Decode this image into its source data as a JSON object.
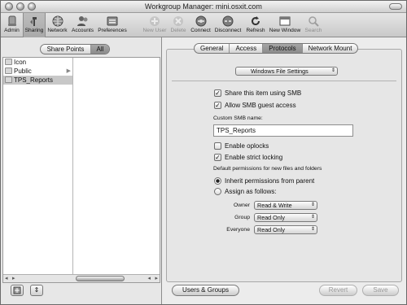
{
  "window": {
    "title": "Workgroup Manager: mini.osxit.com"
  },
  "toolbar": {
    "items": [
      {
        "label": "Admin",
        "icon": "admin-icon",
        "enabled": true
      },
      {
        "label": "Sharing",
        "icon": "sharing-icon",
        "enabled": true,
        "selected": true
      },
      {
        "label": "Network",
        "icon": "network-icon",
        "enabled": true
      },
      {
        "label": "Accounts",
        "icon": "accounts-icon",
        "enabled": true
      },
      {
        "label": "Preferences",
        "icon": "preferences-icon",
        "enabled": true
      },
      {
        "label": "New User",
        "icon": "new-user-icon",
        "enabled": false
      },
      {
        "label": "Delete",
        "icon": "delete-icon",
        "enabled": false
      },
      {
        "label": "Connect",
        "icon": "connect-icon",
        "enabled": true
      },
      {
        "label": "Disconnect",
        "icon": "disconnect-icon",
        "enabled": true
      },
      {
        "label": "Refresh",
        "icon": "refresh-icon",
        "enabled": true
      },
      {
        "label": "New Window",
        "icon": "new-window-icon",
        "enabled": true
      },
      {
        "label": "Search",
        "icon": "search-icon",
        "enabled": false
      }
    ]
  },
  "sidebar": {
    "segments": [
      {
        "label": "Share Points",
        "selected": false
      },
      {
        "label": "All",
        "selected": true
      }
    ],
    "items": [
      {
        "label": "Icon",
        "has_children": false,
        "selected": false
      },
      {
        "label": "Public",
        "has_children": true,
        "selected": false
      },
      {
        "label": "TPS_Reports",
        "has_children": false,
        "selected": true
      }
    ]
  },
  "tabs": [
    {
      "label": "General",
      "selected": false
    },
    {
      "label": "Access",
      "selected": false
    },
    {
      "label": "Protocols",
      "selected": true
    },
    {
      "label": "Network Mount",
      "selected": false
    }
  ],
  "protocol_popup": "Windows File Settings",
  "settings": {
    "share_smb": {
      "label": "Share this item using SMB",
      "checked": true
    },
    "allow_guest": {
      "label": "Allow SMB guest access",
      "checked": true
    },
    "custom_name_label": "Custom SMB name:",
    "custom_name_value": "TPS_Reports",
    "oplocks": {
      "label": "Enable oplocks",
      "checked": false
    },
    "strict_locking": {
      "label": "Enable strict locking",
      "checked": true
    },
    "default_perms_label": "Default permissions for new files and folders",
    "inherit": {
      "label": "Inherit permissions from parent",
      "selected": true
    },
    "assign": {
      "label": "Assign as follows:",
      "selected": false
    },
    "perms": [
      {
        "label": "Owner",
        "value": "Read & Write"
      },
      {
        "label": "Group",
        "value": "Read Only"
      },
      {
        "label": "Everyone",
        "value": "Read Only"
      }
    ]
  },
  "buttons": {
    "users_groups": "Users & Groups",
    "revert": "Revert",
    "save": "Save"
  },
  "glyphs": {
    "check": "✓",
    "chevron": "⇕",
    "arrow_right": "▸",
    "arrow_left": "◂",
    "expand": "▶"
  }
}
